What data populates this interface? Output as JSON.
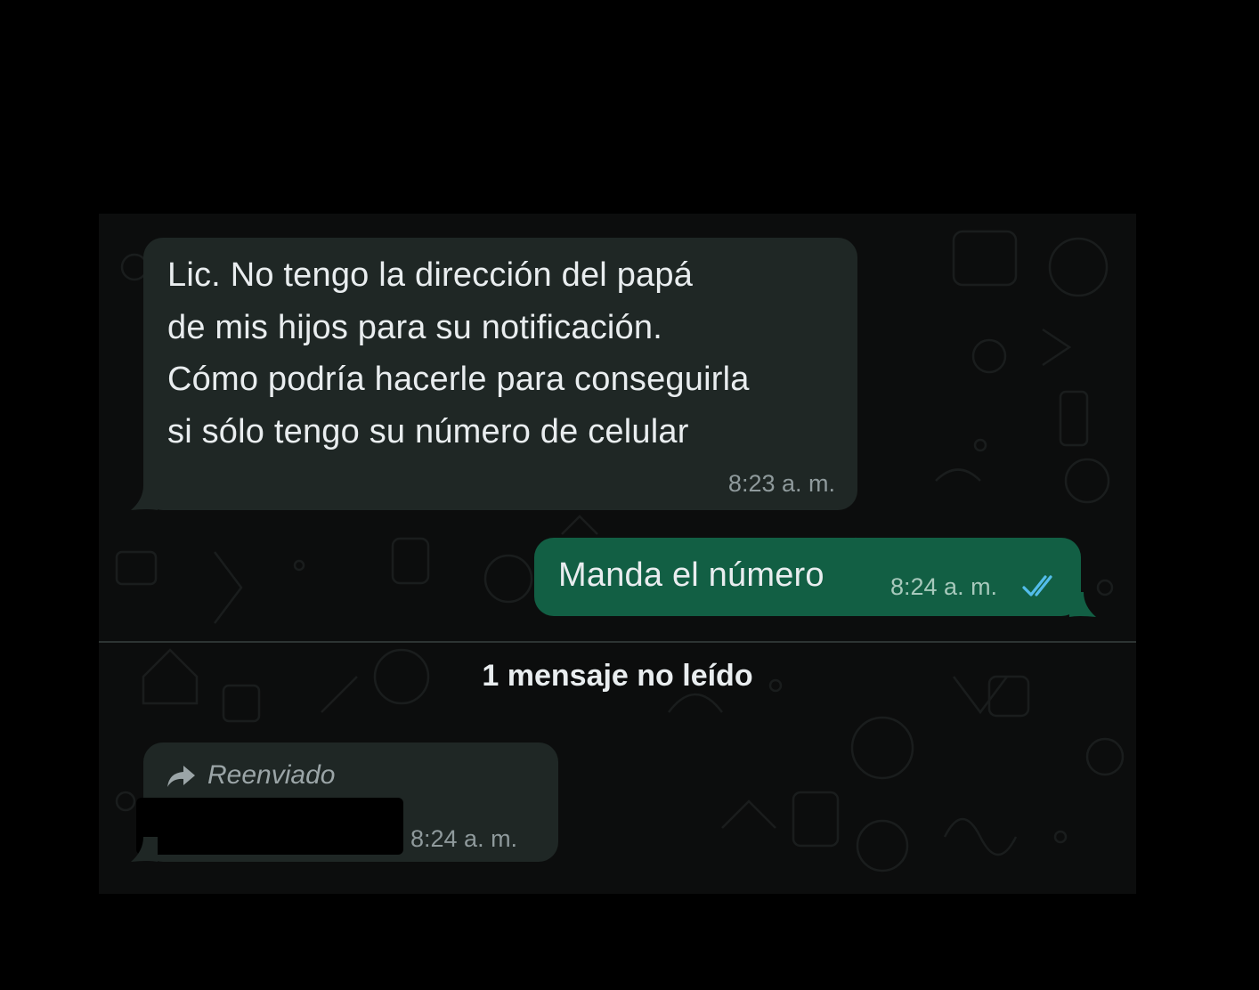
{
  "messages": [
    {
      "direction": "incoming",
      "text": "Lic. No tengo la dirección del papá\nde mis hijos para su notificación.\nCómo podría hacerle para conseguirla\nsi sólo tengo su número de celular",
      "time": "8:23 a. m."
    },
    {
      "direction": "outgoing",
      "text": "Manda el número",
      "time": "8:24 a. m.",
      "status_icon": "double-check-read-icon",
      "status_color": "#53bdeb"
    }
  ],
  "unread_divider": {
    "label": "1 mensaje no leído"
  },
  "forwarded_message": {
    "forward_icon": "forward-arrow-icon",
    "label": "Reenviado",
    "time": "8:24 a. m.",
    "content_redacted": true
  },
  "colors": {
    "incoming_bubble": "#1f2725",
    "outgoing_bubble": "#125f44",
    "background": "#0c0d0d",
    "read_check": "#53bdeb"
  }
}
